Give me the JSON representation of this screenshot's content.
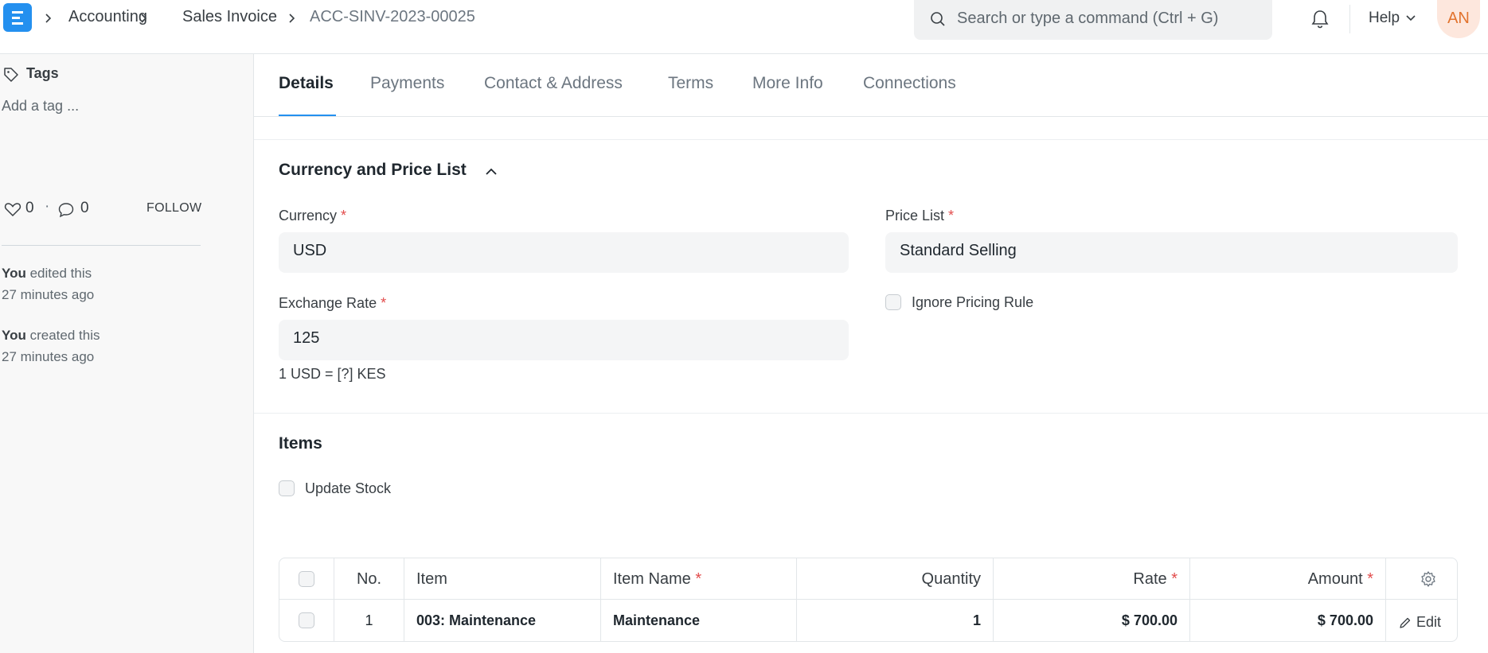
{
  "navbar": {
    "breadcrumbs": [
      "Accounting",
      "Sales Invoice",
      "ACC-SINV-2023-00025"
    ],
    "search_placeholder": "Search or type a command (Ctrl + G)",
    "help_label": "Help",
    "avatar_initials": "AN"
  },
  "sidebar": {
    "tags_label": "Tags",
    "add_tag": "Add a tag ...",
    "likes": "0",
    "separator": "·",
    "comments": "0",
    "follow_label": "FOLLOW",
    "activity": [
      {
        "user": "You",
        "action": "edited this",
        "time": "27 minutes ago"
      },
      {
        "user": "You",
        "action": "created this",
        "time": "27 minutes ago"
      }
    ]
  },
  "tabs": [
    "Details",
    "Payments",
    "Contact & Address",
    "Terms",
    "More Info",
    "Connections"
  ],
  "currency_section": {
    "title": "Currency and Price List",
    "currency_label": "Currency",
    "currency_value": "USD",
    "exchange_rate_label": "Exchange Rate",
    "exchange_rate_value": "125",
    "exchange_rate_desc": "1 USD = [?] KES",
    "price_list_label": "Price List",
    "price_list_value": "Standard Selling",
    "ignore_pricing_rule_label": "Ignore Pricing Rule",
    "required_mark": "*"
  },
  "items_section": {
    "title": "Items",
    "update_stock_label": "Update Stock",
    "columns": {
      "no": "No.",
      "item": "Item",
      "item_name": "Item Name",
      "quantity": "Quantity",
      "rate": "Rate",
      "amount": "Amount"
    },
    "rows": [
      {
        "no": "1",
        "item": "003: Maintenance",
        "item_name": "Maintenance",
        "quantity": "1",
        "rate": "$ 700.00",
        "amount": "$ 700.00"
      }
    ],
    "edit_label": "Edit"
  },
  "colors": {
    "primary": "#2490ef",
    "required": "#e24c4c",
    "avatar_bg": "#fde7dd",
    "avatar_text": "#e2732e"
  }
}
